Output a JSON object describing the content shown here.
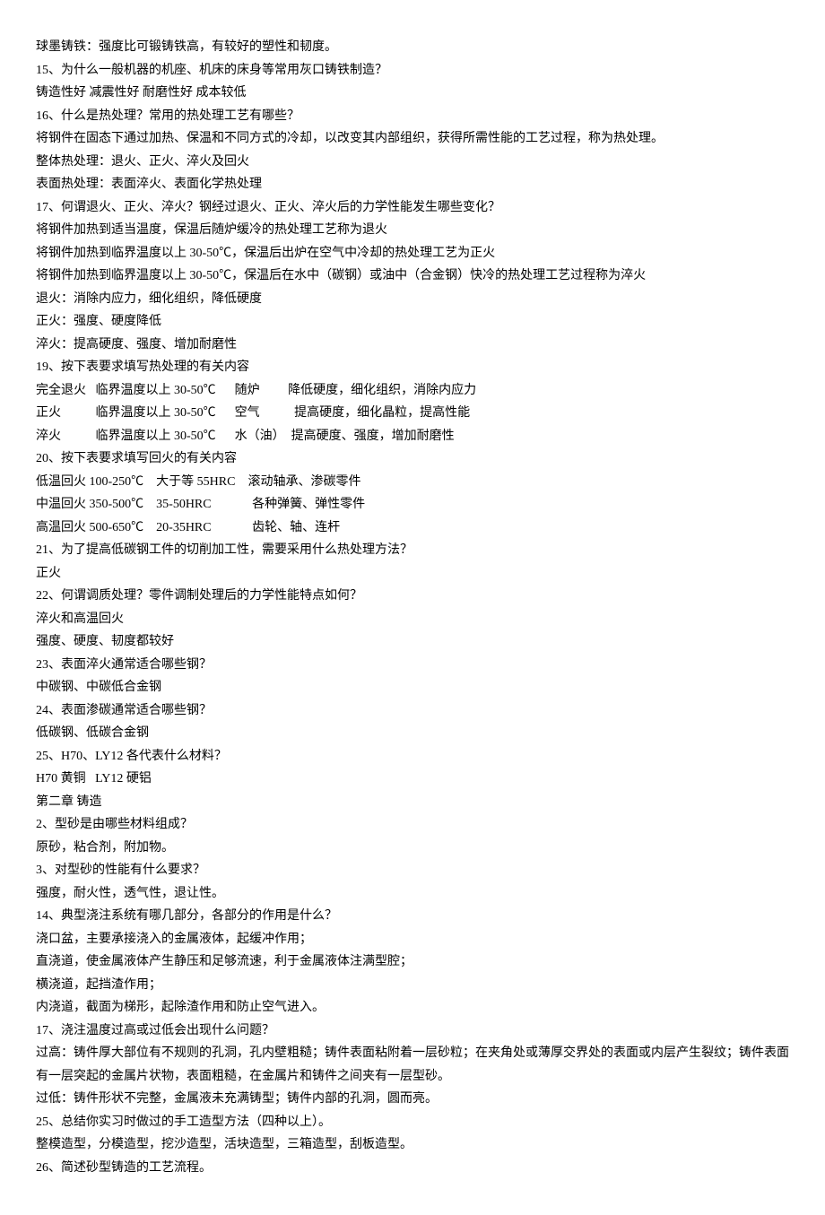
{
  "lines": [
    "球墨铸铁：强度比可锻铸铁高，有较好的塑性和韧度。",
    "15、为什么一般机器的机座、机床的床身等常用灰口铸铁制造？",
    "铸造性好 减震性好 耐磨性好 成本较低",
    "16、什么是热处理？常用的热处理工艺有哪些？",
    "将钢件在固态下通过加热、保温和不同方式的冷却，以改变其内部组织，获得所需性能的工艺过程，称为热处理。",
    "整体热处理：退火、正火、淬火及回火",
    "表面热处理：表面淬火、表面化学热处理",
    "17、何谓退火、正火、淬火？钢经过退火、正火、淬火后的力学性能发生哪些变化？",
    "将钢件加热到适当温度，保温后随炉缓冷的热处理工艺称为退火",
    "将钢件加热到临界温度以上 30-50℃，保温后出炉在空气中冷却的热处理工艺为正火",
    "将钢件加热到临界温度以上 30-50℃，保温后在水中（碳钢）或油中（合金钢）快冷的热处理工艺过程称为淬火",
    "退火：消除内应力，细化组织，降低硬度",
    "正火：强度、硬度降低",
    "淬火：提高硬度、强度、增加耐磨性",
    "19、按下表要求填写热处理的有关内容",
    "完全退火   临界温度以上 30-50℃      随炉         降低硬度，细化组织，消除内应力",
    "正火           临界温度以上 30-50℃      空气           提高硬度，细化晶粒，提高性能",
    "淬火           临界温度以上 30-50℃      水（油）  提高硬度、强度，增加耐磨性",
    "20、按下表要求填写回火的有关内容",
    "低温回火 100-250℃    大于等 55HRC    滚动轴承、渗碳零件",
    "中温回火 350-500℃    35-50HRC             各种弹簧、弹性零件",
    "高温回火 500-650℃    20-35HRC             齿轮、轴、连杆",
    "21、为了提高低碳钢工件的切削加工性，需要采用什么热处理方法？",
    "正火",
    "22、何谓调质处理？零件调制处理后的力学性能特点如何？",
    "淬火和高温回火",
    "强度、硬度、韧度都较好",
    "23、表面淬火通常适合哪些钢？",
    "中碳钢、中碳低合金钢",
    "24、表面渗碳通常适合哪些钢？",
    "低碳钢、低碳合金钢",
    "25、H70、LY12 各代表什么材料？",
    "H70 黄铜   LY12 硬铝",
    "第二章 铸造",
    "2、型砂是由哪些材料组成？",
    "原砂，粘合剂，附加物。",
    "3、对型砂的性能有什么要求？",
    "强度，耐火性，透气性，退让性。",
    "14、典型浇注系统有哪几部分，各部分的作用是什么？",
    "浇口盆，主要承接浇入的金属液体，起缓冲作用；",
    "直浇道，使金属液体产生静压和足够流速，利于金属液体注满型腔；",
    "横浇道，起挡渣作用；",
    "内浇道，截面为梯形，起除渣作用和防止空气进入。",
    "17、浇注温度过高或过低会出现什么问题？",
    "过高：铸件厚大部位有不规则的孔洞，孔内壁粗糙；铸件表面粘附着一层砂粒；在夹角处或薄厚交界处的表面或内层产生裂纹；铸件表面有一层突起的金属片状物，表面粗糙，在金属片和铸件之间夹有一层型砂。",
    "过低：铸件形状不完整，金属液未充满铸型；铸件内部的孔洞，圆而亮。",
    "25、总结你实习时做过的手工造型方法（四种以上）。",
    "整模造型，分模造型，挖沙造型，活块造型，三箱造型，刮板造型。",
    "26、简述砂型铸造的工艺流程。"
  ]
}
